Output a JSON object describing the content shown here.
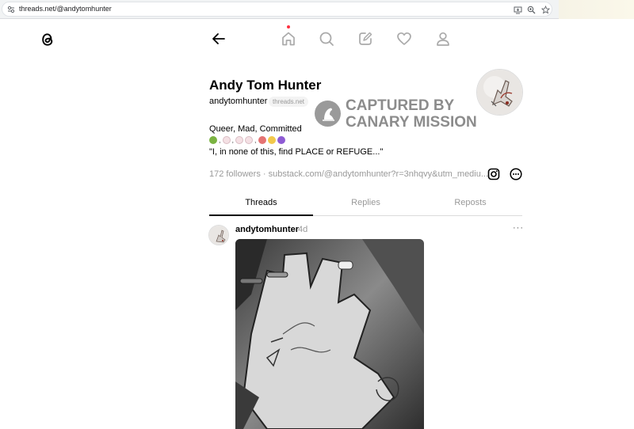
{
  "browser": {
    "url": "threads.net/@andytomhunter",
    "icons": [
      "tune-icon",
      "install-app-icon",
      "zoom-icon",
      "bookmark-star-icon"
    ]
  },
  "nav": {
    "icons": [
      "threads-logo-icon",
      "back-arrow-icon",
      "home-icon",
      "search-icon",
      "compose-icon",
      "heart-icon",
      "profile-icon"
    ],
    "notification_color": "#ff3040"
  },
  "profile": {
    "display_name": "Andy Tom Hunter",
    "username": "andytomhunter",
    "domain_badge": "threads.net",
    "bio_line1": "Queer, Mad, Committed",
    "bio_line3": "\"I, in none of this, find PLACE or REFUGE...\"",
    "followers_line": "172 followers · substack.com/@andytomhunter?r=3nhqvy&utm_mediu..."
  },
  "watermark": {
    "line1": "CAPTURED BY",
    "line2": "CANARY MISSION"
  },
  "tabs": [
    {
      "label": "Threads",
      "active": true
    },
    {
      "label": "Replies",
      "active": false
    },
    {
      "label": "Reposts",
      "active": false
    }
  ],
  "post": {
    "username": "andytomhunter",
    "time": "4d",
    "more": "···"
  }
}
